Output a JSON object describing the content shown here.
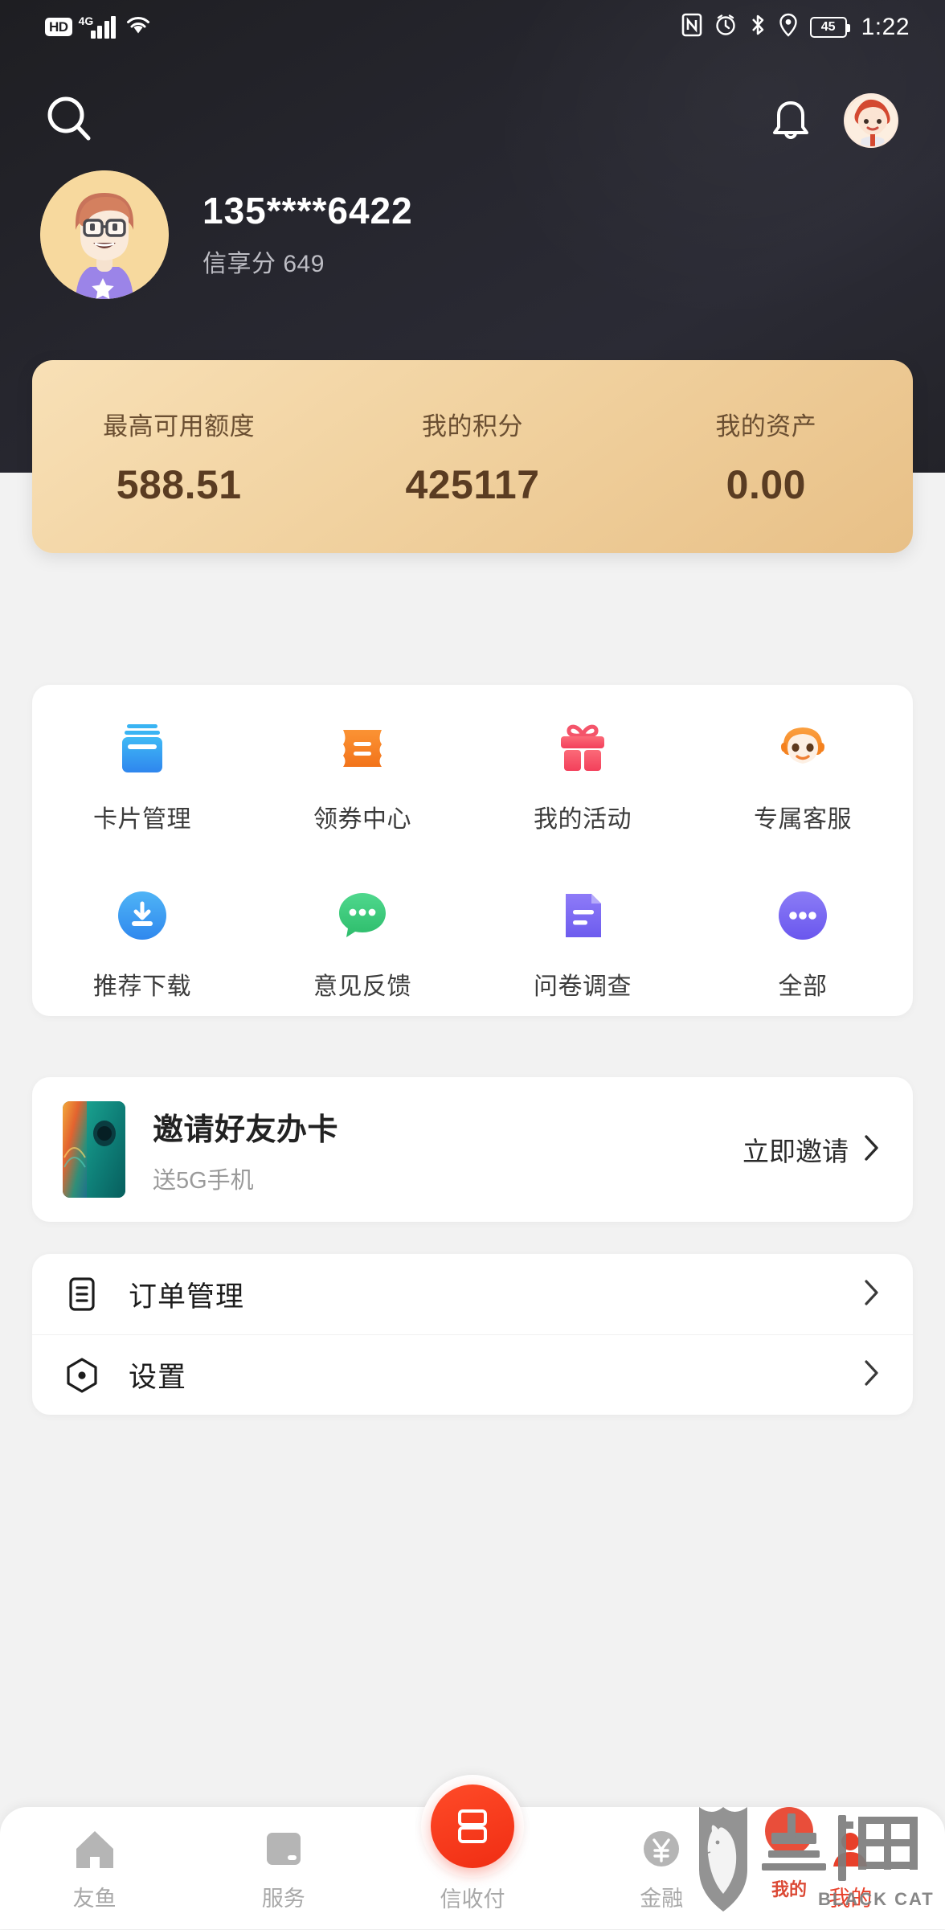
{
  "statusbar": {
    "hd": "HD",
    "network": "4G",
    "signal_icon": "signal-bars-icon",
    "wifi_icon": "wifi-icon",
    "nfc_icon": "nfc-icon",
    "alarm_icon": "alarm-icon",
    "bluetooth_icon": "bluetooth-icon",
    "location_icon": "location-icon",
    "battery_level": "45",
    "time": "1:22"
  },
  "topbar": {
    "search_icon": "search-icon",
    "bell_icon": "bell-icon",
    "avatar_icon": "avatar-icon"
  },
  "profile": {
    "phone": "135****6422",
    "credit_label": "信享分",
    "credit_score": "649"
  },
  "stats": [
    {
      "label": "最高可用额度",
      "value": "588.51"
    },
    {
      "label": "我的积分",
      "value": "425117"
    },
    {
      "label": "我的资产",
      "value": "0.00"
    }
  ],
  "quick_grid": {
    "row1": [
      {
        "label": "卡片管理",
        "icon": "card-stack-icon",
        "color": "#2f9bf0"
      },
      {
        "label": "领券中心",
        "icon": "coupon-icon",
        "color": "#f58220"
      },
      {
        "label": "我的活动",
        "icon": "gift-icon",
        "color": "#f5455c"
      },
      {
        "label": "专属客服",
        "icon": "customer-service-icon",
        "color": "#f5821f"
      }
    ],
    "row2": [
      {
        "label": "推荐下载",
        "icon": "download-icon",
        "color": "#38a0f0"
      },
      {
        "label": "意见反馈",
        "icon": "chat-bubble-icon",
        "color": "#3ecb78"
      },
      {
        "label": "问卷调查",
        "icon": "survey-document-icon",
        "color": "#7e6ef2"
      },
      {
        "label": "全部",
        "icon": "more-dots-icon",
        "color": "#7766f0"
      }
    ]
  },
  "invite": {
    "title": "邀请好友办卡",
    "subtitle": "送5G手机",
    "cta": "立即邀请",
    "chevron_icon": "chevron-right-icon",
    "thumb_icon": "phone-product-image"
  },
  "menu_rows": [
    {
      "label": "订单管理",
      "icon": "order-list-icon",
      "chevron": "chevron-right-icon"
    },
    {
      "label": "设置",
      "icon": "settings-hex-icon",
      "chevron": "chevron-right-icon"
    }
  ],
  "bottom_nav": {
    "items": [
      {
        "label": "友鱼",
        "icon": "home-icon"
      },
      {
        "label": "服务",
        "icon": "service-card-icon"
      },
      {
        "label": "金融",
        "icon": "yuan-finance-icon"
      },
      {
        "label": "我的",
        "icon": "profile-icon"
      }
    ],
    "center": {
      "label": "信收付",
      "icon": "pay-icon",
      "color": "#f02d13"
    }
  },
  "watermark": {
    "brand_cn": "黑猫",
    "brand_en": "BLACK CAT",
    "shield_icon": "cat-shield-icon"
  },
  "colors": {
    "header_bg": "#232329",
    "gold_card": "#f1d2a0",
    "page_bg": "#f2f2f2",
    "accent_red": "#f02d13"
  }
}
